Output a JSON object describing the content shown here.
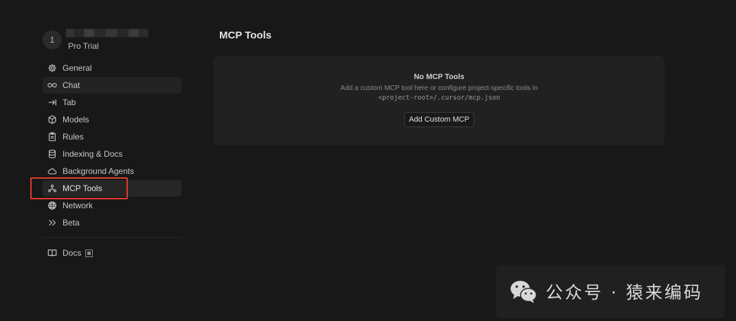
{
  "account": {
    "avatar_initial": "1",
    "plan": "Pro Trial"
  },
  "sidebar": {
    "items": [
      {
        "label": "General",
        "icon": "gear-icon"
      },
      {
        "label": "Chat",
        "icon": "infinity-icon"
      },
      {
        "label": "Tab",
        "icon": "tab-arrow-icon"
      },
      {
        "label": "Models",
        "icon": "cube-icon"
      },
      {
        "label": "Rules",
        "icon": "clipboard-icon"
      },
      {
        "label": "Indexing & Docs",
        "icon": "database-icon"
      },
      {
        "label": "Background Agents",
        "icon": "cloud-icon"
      },
      {
        "label": "MCP Tools",
        "icon": "mcp-icon"
      },
      {
        "label": "Network",
        "icon": "globe-icon"
      },
      {
        "label": "Beta",
        "icon": "double-chevron-icon"
      }
    ],
    "active_item": "MCP Tools",
    "docs_link": {
      "label": "Docs",
      "icon": "book-icon"
    }
  },
  "main": {
    "title": "MCP Tools",
    "empty_state": {
      "title": "No MCP Tools",
      "description": "Add a custom MCP tool here or configure project-specific tools in",
      "path": "<project-root>/.cursor/mcp.json",
      "button_label": "Add Custom MCP"
    }
  },
  "watermark": {
    "text": "公众号 · 猿来编码",
    "icon": "wechat-icon"
  },
  "colors": {
    "background": "#181818",
    "card": "#212121",
    "highlight": "#e23b2e"
  }
}
